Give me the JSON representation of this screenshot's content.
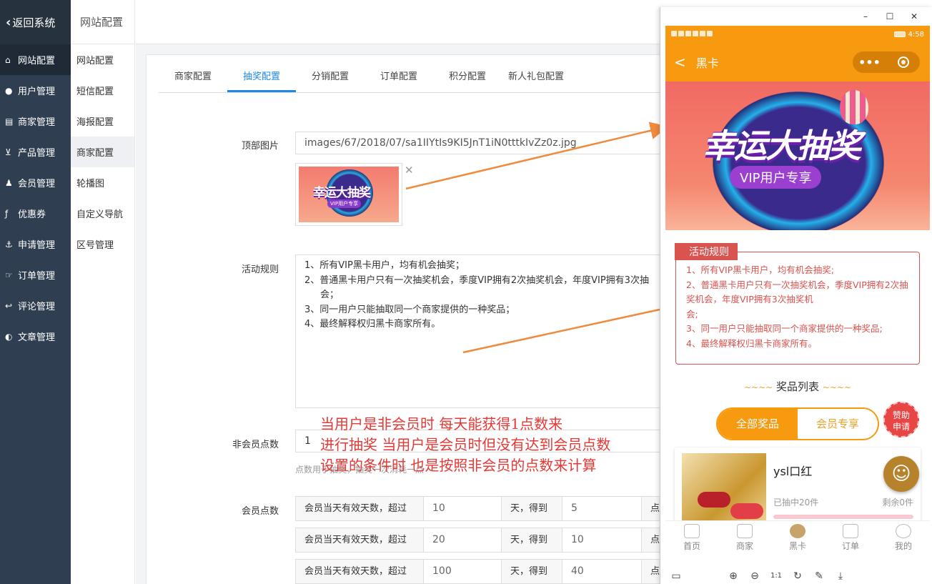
{
  "sidebar": {
    "back_label": "返回系统",
    "items": [
      {
        "label": "网站配置",
        "icon": "home-icon"
      },
      {
        "label": "用户管理",
        "icon": "user-icon"
      },
      {
        "label": "商家管理",
        "icon": "card-icon"
      },
      {
        "label": "产品管理",
        "icon": "cart-icon"
      },
      {
        "label": "会员管理",
        "icon": "members-icon"
      },
      {
        "label": "优惠券",
        "icon": "coupon-icon"
      },
      {
        "label": "申请管理",
        "icon": "anchor-icon"
      },
      {
        "label": "订单管理",
        "icon": "thumb-icon"
      },
      {
        "label": "评论管理",
        "icon": "reply-icon"
      },
      {
        "label": "文章管理",
        "icon": "contrast-icon"
      }
    ]
  },
  "subnav": {
    "header": "网站配置",
    "items": [
      "网站配置",
      "短信配置",
      "海报配置",
      "商家配置",
      "轮播图",
      "自定义导航",
      "区号管理"
    ]
  },
  "tabs": [
    "商家配置",
    "抽奖配置",
    "分销配置",
    "订单配置",
    "积分配置",
    "新人礼包配置"
  ],
  "form": {
    "top_image_label": "顶部图片",
    "top_image_path": "images/67/2018/07/sa1IIYtIs9KI5JnT1iN0tttkIvZz0z.jpg",
    "thumb_title": "幸运大抽奖",
    "thumb_sub": "VIP用户专享",
    "rules_label": "活动规则",
    "rules": [
      "1、所有VIP黑卡用户，均有机会抽奖；",
      "2、普通黑卡用户只有一次抽奖机会，季度VIP拥有2次抽奖机会，年度VIP拥有3次抽",
      "会；",
      "3、同一用户只能抽取同一个商家提供的一种奖品；",
      "4、最终解释权归黑卡商家所有。"
    ],
    "nonmember_label": "非会员点数",
    "nonmember_value": "1",
    "points_hint": "点数用于抽奖，抽奖一次消耗一点",
    "member_label": "会员点数",
    "member_rows": [
      {
        "prefix": "会员当天有效天数，超过",
        "days": "10",
        "mid": "天，得到",
        "points": "5",
        "suffix": "点数"
      },
      {
        "prefix": "会员当天有效天数，超过",
        "days": "20",
        "mid": "天，得到",
        "points": "10",
        "suffix": "点数"
      },
      {
        "prefix": "会员当天有效天数，超过",
        "days": "100",
        "mid": "天，得到",
        "points": "40",
        "suffix": "点数"
      }
    ]
  },
  "annotation": {
    "lines": [
      "当用户是非会员时  每天能获得1点数来",
      "进行抽奖  当用户是会员时但没有达到会员点数",
      "设置的条件时  也是按照非会员的点数来计算"
    ],
    "color": "#e53935"
  },
  "phone": {
    "window_controls": [
      "–",
      "☐",
      "✕"
    ],
    "time": "4:58",
    "nav_back": "<",
    "nav_title": "黑卡",
    "capsule_dots": "•••",
    "banner_title": "幸运大抽奖",
    "banner_sub": "VIP用户专享",
    "rules_tag": "活动规则",
    "rules": [
      "1、所有VIP黑卡用户，均有机会抽奖;",
      "2、普通黑卡用户只有一次抽奖机会，季度VIP拥有2次抽奖机会，年度VIP拥有3次抽奖机",
      "会;",
      "3、同一用户只能抽取同一个商家提供的一种奖品;",
      "4、最终解释权归黑卡商家所有。"
    ],
    "prize_list_title": "奖品列表",
    "prize_tilde": "~~~~",
    "segment_all": "全部奖品",
    "segment_member": "会员专享",
    "sponsor_line1": "赞助",
    "sponsor_line2": "申请",
    "prize": {
      "name": "ysl口红",
      "won": "已抽中20件",
      "left": "剩余0件"
    },
    "float_icon": "smile-icon",
    "tabbar": [
      "首页",
      "商家",
      "黑卡",
      "订单",
      "我的"
    ],
    "toolbar_icons": [
      "layout-icon",
      "zoom-in-icon",
      "zoom-out-icon",
      "one-to-one-icon",
      "refresh-icon",
      "edit-icon",
      "download-icon"
    ],
    "toolbar_glyphs": [
      "▭",
      "⊕",
      "⊖",
      "1:1",
      "↻",
      "✎",
      "⤓"
    ]
  },
  "colors": {
    "sidebar_bg": "#2f3e50",
    "accent_blue": "#1e88e5",
    "phone_orange": "#f79a10",
    "rule_red": "#d9534f",
    "arrow_orange": "#f08a3c"
  }
}
